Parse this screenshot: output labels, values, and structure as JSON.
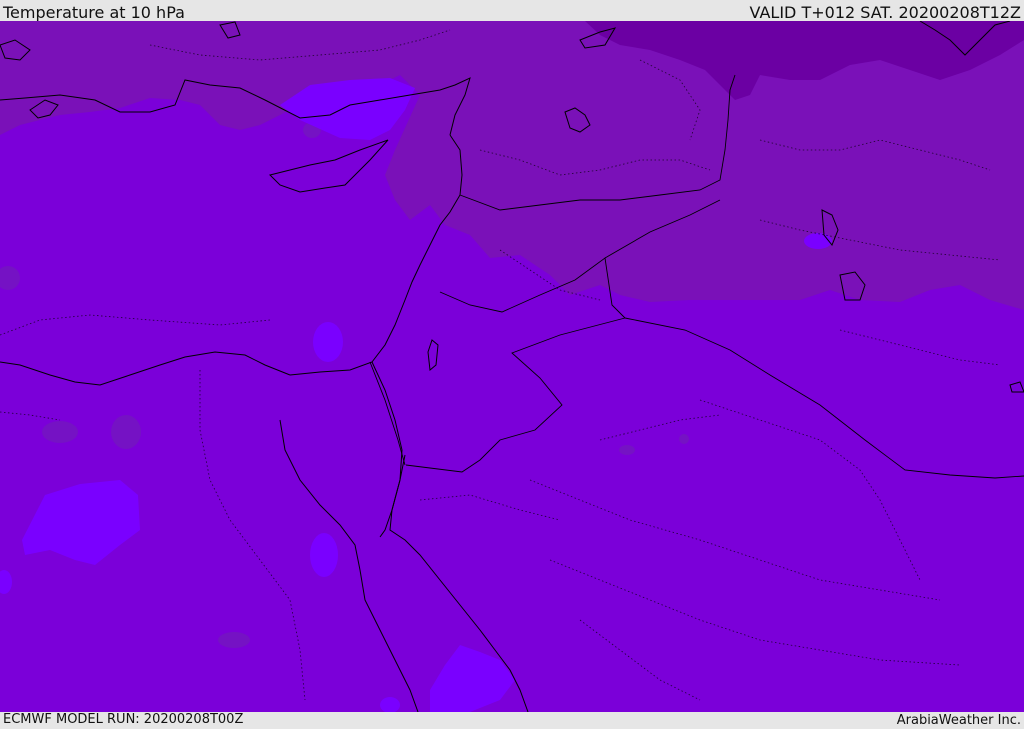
{
  "header": {
    "title": "Temperature at 10 hPa",
    "valid_time": "VALID T+012 SAT. 20200208T12Z"
  },
  "footer": {
    "model_run": "ECMWF MODEL RUN: 20200208T00Z",
    "credit": "ArabiaWeather Inc."
  },
  "map": {
    "field": "Temperature",
    "level": "10 hPa",
    "colors": {
      "dominant_fill": "#7b00d9",
      "northern_band": "#7a11b8",
      "far_north_band": "#6b00a3",
      "warm_pockets": "#7512c4",
      "cold_pockets": "#7a00ff",
      "coastline": "#000000"
    }
  }
}
